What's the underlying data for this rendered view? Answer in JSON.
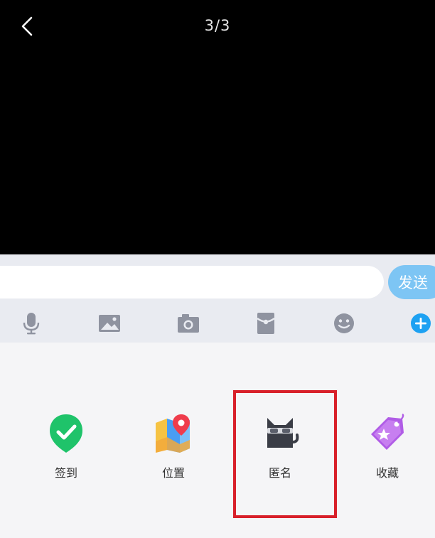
{
  "viewer": {
    "page_counter": "3/3"
  },
  "input": {
    "value": "",
    "send_label": "发送"
  },
  "toolbar": {
    "icons": [
      "microphone-icon",
      "image-icon",
      "camera-icon",
      "red-packet-icon",
      "emoji-icon",
      "plus-icon"
    ]
  },
  "features": [
    {
      "label": "签到",
      "icon": "checkin-shield-icon"
    },
    {
      "label": "位置",
      "icon": "location-map-icon"
    },
    {
      "label": "匿名",
      "icon": "anonymous-cat-icon"
    },
    {
      "label": "收藏",
      "icon": "favorite-tag-icon"
    }
  ],
  "colors": {
    "send_button": "#7dc5f4",
    "toolbar_icon": "#8f93a0",
    "plus_icon": "#1da1f2",
    "highlight": "#d8202a",
    "checkin_green": "#1fc36a",
    "favorite_purple": "#b05ce6"
  }
}
